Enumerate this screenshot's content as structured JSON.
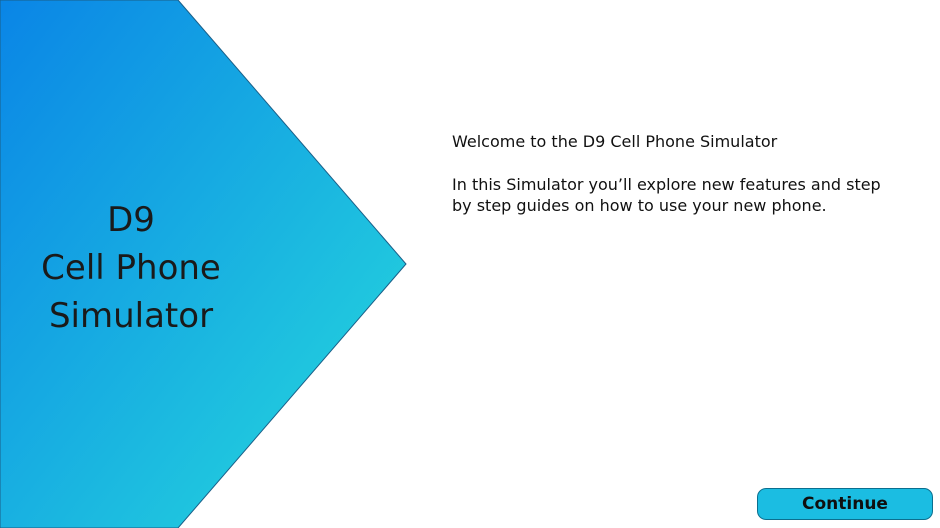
{
  "hero": {
    "title_lines": [
      "D9",
      "Cell Phone",
      "Simulator"
    ]
  },
  "content": {
    "welcome": "Welcome to the D9 Cell Phone Simulator",
    "intro": "In this Simulator you’ll explore new features and step by step guides on how to use your new phone."
  },
  "actions": {
    "continue_label": "Continue"
  },
  "colors": {
    "gradient_start": "#0a85e6",
    "gradient_end": "#27dcdc",
    "button_fill": "#1bbde2",
    "button_border": "#0b6f8f"
  }
}
